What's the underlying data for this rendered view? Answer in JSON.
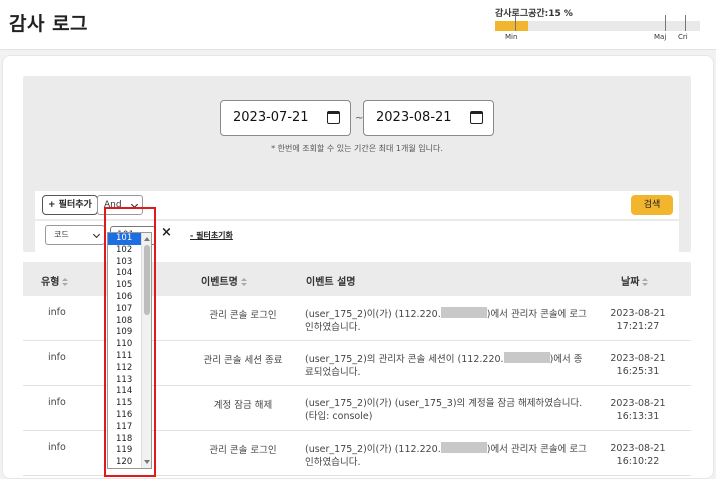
{
  "page": {
    "title": "감사 로그"
  },
  "storage_meter": {
    "label": "감사로그공간:15 %",
    "percent": 15,
    "marks": [
      "Min",
      "Maj",
      "Cri"
    ],
    "fill_color": "#f2b52e"
  },
  "filter": {
    "start_date": "2023-07-21",
    "end_date": "2023-08-21",
    "range_separator": "~",
    "notice": "* 한번에 조회할 수 있는 기간은 최대 1개월 입니다.",
    "add_filter_label": "+ 필터추가",
    "operator": "And",
    "search_label": "검색",
    "condition": {
      "field": "코드",
      "value": "101",
      "remove_icon": "×",
      "reset_label": "- 필터초기화"
    },
    "value_options": [
      "101",
      "102",
      "103",
      "104",
      "105",
      "106",
      "107",
      "108",
      "109",
      "110",
      "111",
      "112",
      "113",
      "114",
      "115",
      "116",
      "117",
      "118",
      "119",
      "120"
    ],
    "selected_option": "101"
  },
  "table": {
    "headers": {
      "type": "유형",
      "event_name": "이벤트명",
      "event_desc": "이벤트 설명",
      "date": "날짜"
    },
    "rows": [
      {
        "type": "info",
        "event_name": "관리 콘솔 로그인",
        "desc_a": "(user_175_2)이(가) (112.220.",
        "desc_b": ")에서 관리자 콘솔에 로그인하였습니다.",
        "masked": true,
        "date": "2023-08-21",
        "time": "17:21:27"
      },
      {
        "type": "info",
        "event_name": "관리 콘솔 세션 종료",
        "desc_a": "(user_175_2)의 관리자 콘솔 세션이 (112.220.",
        "desc_b": ")에서 종료되었습니다.",
        "masked": true,
        "date": "2023-08-21",
        "time": "16:25:31"
      },
      {
        "type": "info",
        "event_name": "계정 잠금 해제",
        "desc_a": "(user_175_2)이(가) (user_175_3)의 계정을 잠금 해제하였습니다. (타입: console)",
        "desc_b": "",
        "masked": false,
        "date": "2023-08-21",
        "time": "16:13:31"
      },
      {
        "type": "info",
        "event_name": "관리 콘솔 로그인",
        "desc_a": "(user_175_2)이(가) (112.220.",
        "desc_b": ")에서 관리자 콘솔에 로그인하였습니다.",
        "masked": true,
        "date": "2023-08-21",
        "time": "16:10:22"
      }
    ]
  }
}
